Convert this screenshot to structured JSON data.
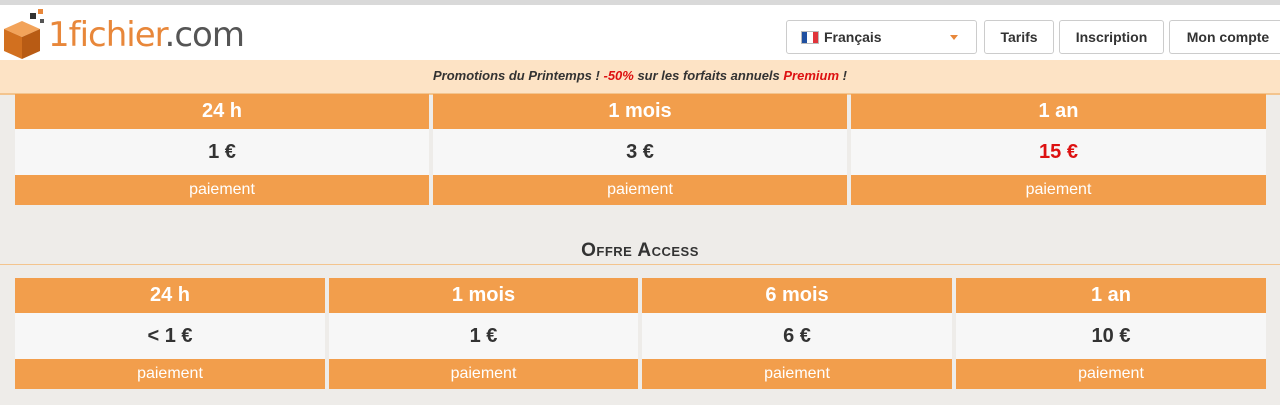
{
  "header": {
    "logo_text": "1fichier",
    "logo_domain": ".com",
    "language": "Français",
    "nav": [
      "Tarifs",
      "Inscription",
      "Mon compte"
    ]
  },
  "promo": {
    "lead": "Promotions du Printemps ! ",
    "discount": "-50%",
    "middle": " sur les forfaits annuels ",
    "product": "Premium",
    "tail": " !"
  },
  "premium": {
    "plans": [
      {
        "duration": "24 h",
        "price": "1 €",
        "pay": "paiement"
      },
      {
        "duration": "1 mois",
        "price": "3 €",
        "pay": "paiement"
      },
      {
        "duration": "1 an",
        "price": "15 €",
        "pay": "paiement"
      }
    ]
  },
  "access": {
    "title": "Offre Access",
    "plans": [
      {
        "duration": "24 h",
        "price": "< 1 €",
        "pay": "paiement"
      },
      {
        "duration": "1 mois",
        "price": "1 €",
        "pay": "paiement"
      },
      {
        "duration": "6 mois",
        "price": "6 €",
        "pay": "paiement"
      },
      {
        "duration": "1 an",
        "price": "10 €",
        "pay": "paiement"
      }
    ]
  },
  "colors": {
    "accent": "#f29e4c",
    "promo_bg": "#fde3c5",
    "highlight": "#dd1111"
  }
}
